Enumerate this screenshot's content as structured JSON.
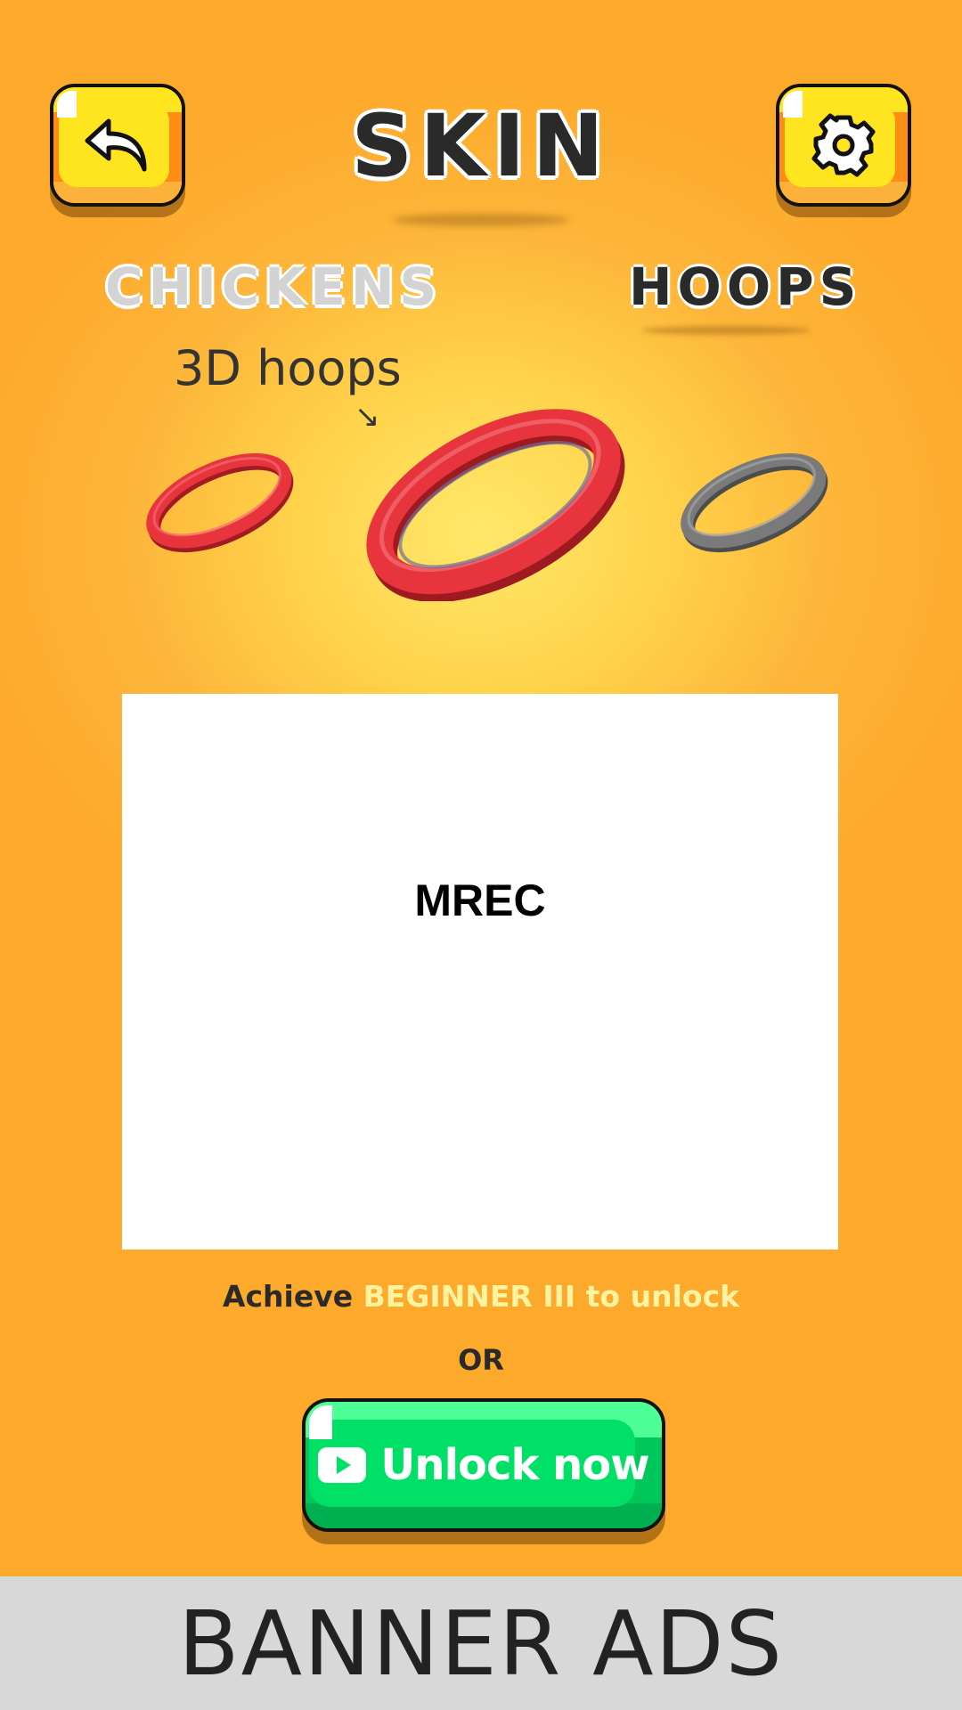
{
  "screen": {
    "title": "SKIN"
  },
  "tabs": [
    {
      "label": "CHICKENS",
      "active": false
    },
    {
      "label": "HOOPS",
      "active": true
    }
  ],
  "annotation": {
    "text": "3D hoops",
    "arrow": "↘"
  },
  "hoops": [
    {
      "color": "#e8343d",
      "selected": false
    },
    {
      "color": "#e8343d",
      "selected": true
    },
    {
      "color": "#7a7a7a",
      "selected": false
    }
  ],
  "mrec": {
    "label": "MREC"
  },
  "unlock": {
    "prefix": "Achieve ",
    "level": "BEGINNER III",
    "suffix": " to unlock",
    "or": "OR",
    "button_label": "Unlock now"
  },
  "banner": {
    "label": "BANNER ADS"
  },
  "icons": {
    "back": "back-arrow-icon",
    "settings": "gear-icon",
    "video": "play-video-icon"
  },
  "colors": {
    "background": "#fda92b",
    "button_yellow": "#ffe51f",
    "button_green": "#00e066",
    "highlight": "#fff3a0"
  }
}
